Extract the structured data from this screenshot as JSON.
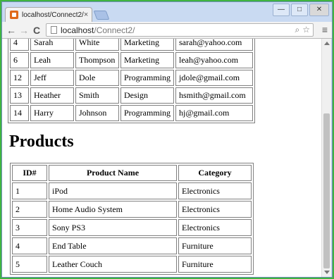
{
  "browser": {
    "tab_title": "localhost/Connect2/",
    "tab_close": "×",
    "window_controls": {
      "minimize": "—",
      "maximize": "□",
      "close": "✕"
    },
    "nav": {
      "back": "←",
      "forward": "→",
      "reload": "C"
    },
    "url_host": "localhost",
    "url_path": "/Connect2/",
    "menu": "≡"
  },
  "employees": {
    "rows": [
      [
        "4",
        "Sarah",
        "White",
        "Marketing",
        "sarah@yahoo.com"
      ],
      [
        "6",
        "Leah",
        "Thompson",
        "Marketing",
        "leah@yahoo.com"
      ],
      [
        "12",
        "Jeff",
        "Dole",
        "Programming",
        "jdole@gmail.com"
      ],
      [
        "13",
        "Heather",
        "Smith",
        "Design",
        "hsmith@gmail.com"
      ],
      [
        "14",
        "Harry",
        "Johnson",
        "Programming",
        "hj@gmail.com"
      ]
    ]
  },
  "products": {
    "heading": "Products",
    "headers": [
      "ID#",
      "Product Name",
      "Category"
    ],
    "rows": [
      [
        "1",
        "iPod",
        "Electronics"
      ],
      [
        "2",
        "Home Audio System",
        "Electronics"
      ],
      [
        "3",
        "Sony PS3",
        "Electronics"
      ],
      [
        "4",
        "End Table",
        "Furniture"
      ],
      [
        "5",
        "Leather Couch",
        "Furniture"
      ]
    ]
  }
}
